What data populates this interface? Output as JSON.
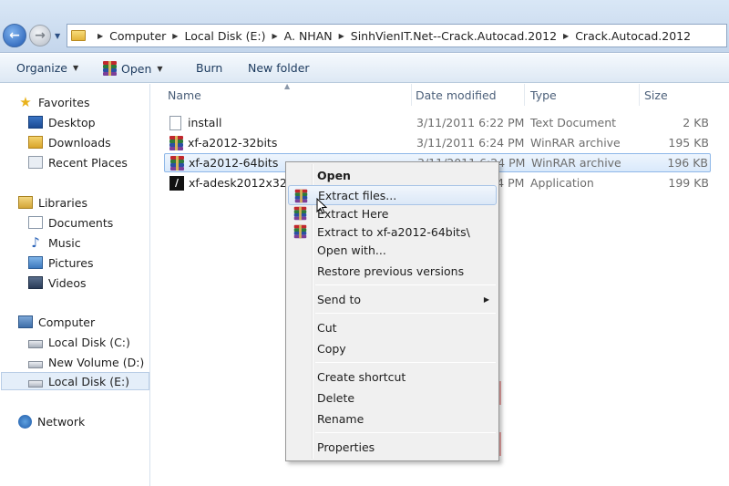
{
  "address": {
    "crumbs": [
      "Computer",
      "Local Disk (E:)",
      "A. NHAN",
      "SinhVienIT.Net--Crack.Autocad.2012",
      "Crack.Autocad.2012"
    ]
  },
  "toolbar": {
    "organize": "Organize",
    "open": "Open",
    "burn": "Burn",
    "new_folder": "New folder"
  },
  "sidebar": {
    "favorites": "Favorites",
    "desktop": "Desktop",
    "downloads": "Downloads",
    "recent_places": "Recent Places",
    "libraries": "Libraries",
    "documents": "Documents",
    "music": "Music",
    "pictures": "Pictures",
    "videos": "Videos",
    "computer": "Computer",
    "local_c": "Local Disk (C:)",
    "new_volume_d": "New Volume (D:)",
    "local_e": "Local Disk (E:)",
    "network": "Network"
  },
  "columns": {
    "name": "Name",
    "date": "Date modified",
    "type": "Type",
    "size": "Size"
  },
  "files": [
    {
      "name": "install",
      "date": "3/11/2011 6:22 PM",
      "type": "Text Document",
      "size": "2 KB"
    },
    {
      "name": "xf-a2012-32bits",
      "date": "3/11/2011 6:24 PM",
      "type": "WinRAR archive",
      "size": "195 KB"
    },
    {
      "name": "xf-a2012-64bits",
      "date": "3/11/2011 6:24 PM",
      "type": "WinRAR archive",
      "size": "196 KB"
    },
    {
      "name": "xf-adesk2012x32",
      "date": "3/11/2011 6:24 PM",
      "type": "Application",
      "size": "199 KB"
    }
  ],
  "context_menu": {
    "open": "Open",
    "extract_files": "Extract files...",
    "extract_here": "Extract Here",
    "extract_to": "Extract to xf-a2012-64bits\\",
    "open_with": "Open with...",
    "restore": "Restore previous versions",
    "send_to": "Send to",
    "cut": "Cut",
    "copy": "Copy",
    "create_shortcut": "Create shortcut",
    "delete": "Delete",
    "rename": "Rename",
    "properties": "Properties"
  },
  "colors": {
    "selection": "#d9e9fb",
    "toolbar_text": "#1c3a5e",
    "watermark": "#e88a8a"
  }
}
